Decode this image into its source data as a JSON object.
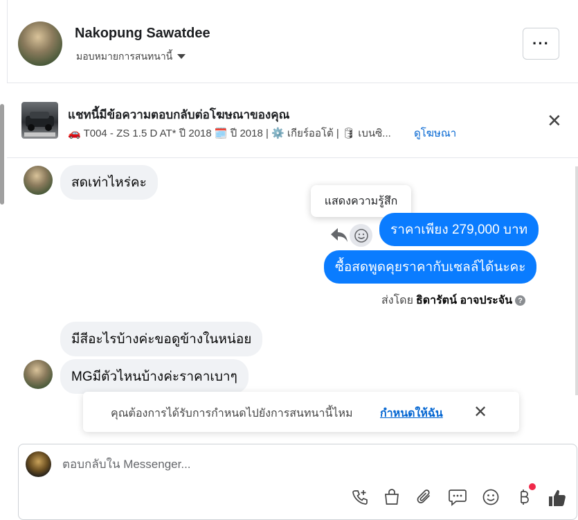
{
  "header": {
    "name": "Nakopung Sawatdee",
    "assign_label": "มอบหมายการสนทนานี้",
    "more_label": "···"
  },
  "ad_banner": {
    "title": "แชทนี้มีข้อความตอบกลับต่อโฆษณาของคุณ",
    "subtitle": "🚗 T004 - ZS 1.5 D AT* ปี 2018 🗓️ ปี 2018 | ⚙️ เกียร์ออโต้ | 🛢 เบนซิ...",
    "view_ad_link": "ดูโฆษณา",
    "close_label": "✕"
  },
  "messages": {
    "m1": "สดเท่าไหร่คะ",
    "m2": "ราคาเพียง 279,000 บาท",
    "m3": "ซื้อสดพูดคุยราคากับเซลล์ได้นะคะ",
    "m4": "มีสีอะไรบ้างค่ะขอดูข้างในหน่อย",
    "m5": "MGมีตัวไหนบ้างค่ะราคาเบาๆ"
  },
  "tooltip": {
    "text": "แสดงความรู้สึก"
  },
  "sent_by": {
    "prefix": "ส่งโดย",
    "agent": "ธิดารัตน์ อาจประจัน",
    "info": "?"
  },
  "toast": {
    "text": "คุณต้องการได้รับการกำหนดไปยังการสนทนานี้ไหม",
    "link": "กำหนดให้ฉัน",
    "close": "✕"
  },
  "composer": {
    "placeholder": "ตอบกลับใน Messenger...",
    "tools": [
      "phone-plus-icon",
      "shopping-bag-icon",
      "paperclip-icon",
      "chat-bubble-icon",
      "smiley-icon",
      "baht-icon",
      "thumbs-up-icon"
    ]
  },
  "colors": {
    "outgoing_bubble": "#0a7cff",
    "incoming_bubble": "#f0f2f5",
    "link": "#0064d1",
    "notification_dot": "#f02849"
  }
}
